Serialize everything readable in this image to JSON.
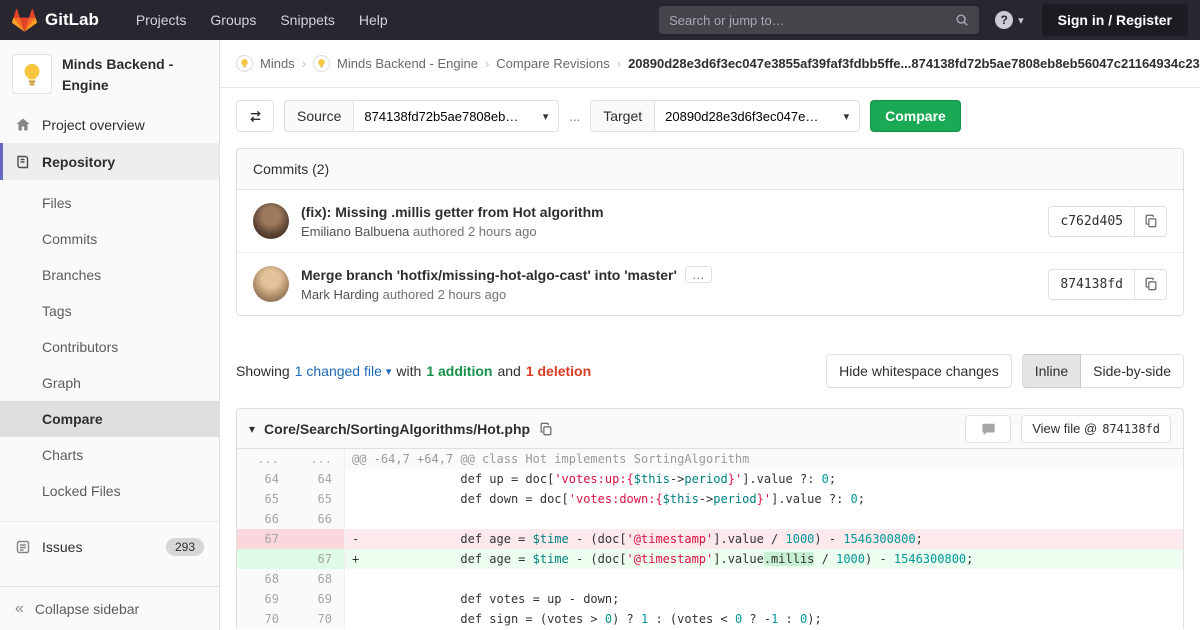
{
  "colors": {
    "navbar_bg": "#28262e",
    "brand_orange": "#e24329",
    "accent_green": "#1aaa55",
    "addition_green": "#168f48",
    "deletion_red": "#db3b21",
    "link_blue": "#1b69b6",
    "sidebar_active_accent": "#6666c4",
    "diff_deletion_bg": "#fbe9eb",
    "diff_addition_bg": "#ecfdf0",
    "diff_addition_word_bg": "#c7f0d2"
  },
  "icons": {
    "chevron_down": "▾",
    "collapse": "«",
    "breadcrumb_separator": "›",
    "ellipsis": "…",
    "question": "?"
  },
  "navbar": {
    "brand": "GitLab",
    "menu": [
      "Projects",
      "Groups",
      "Snippets",
      "Help"
    ],
    "search_placeholder": "Search or jump to…",
    "sign_in": "Sign in / Register"
  },
  "sidebar": {
    "project_title": "Minds Backend - Engine",
    "items": [
      {
        "label": "Project overview"
      },
      {
        "label": "Repository"
      },
      {
        "label": "Files"
      },
      {
        "label": "Commits"
      },
      {
        "label": "Branches"
      },
      {
        "label": "Tags"
      },
      {
        "label": "Contributors"
      },
      {
        "label": "Graph"
      },
      {
        "label": "Compare"
      },
      {
        "label": "Charts"
      },
      {
        "label": "Locked Files"
      },
      {
        "label": "Issues"
      }
    ],
    "issues_count": "293",
    "collapse_label": "Collapse sidebar"
  },
  "breadcrumb": {
    "links": [
      "Minds",
      "Minds Backend - Engine",
      "Compare Revisions"
    ],
    "current": "20890d28e3d6f3ec047e3855af39faf3fdbb5ffe...874138fd72b5ae7808eb8eb56047c21164934c23"
  },
  "compare_form": {
    "source_label": "Source",
    "source_value": "874138fd72b5ae7808eb…",
    "separator": "...",
    "target_label": "Target",
    "target_value": "20890d28e3d6f3ec047e…",
    "compare_button": "Compare"
  },
  "commits": {
    "header": "Commits (2)",
    "items": [
      {
        "title": "(fix): Missing .millis getter from Hot algorithm",
        "author": "Emiliano Balbuena",
        "meta": "authored 2 hours ago",
        "sha": "c762d405"
      },
      {
        "title": "Merge branch 'hotfix/missing-hot-algo-cast' into 'master'",
        "author": "Mark Harding",
        "meta": "authored 2 hours ago",
        "sha": "874138fd"
      }
    ]
  },
  "summary": {
    "showing": "Showing",
    "changed_file": "1 changed file",
    "with_text": "with",
    "addition": "1 addition",
    "and_text": "and",
    "deletion": "1 deletion",
    "hide_whitespace": "Hide whitespace changes",
    "inline": "Inline",
    "side_by_side": "Side-by-side"
  },
  "diff": {
    "file_path": "Core/Search/SortingAlgorithms/Hot.php",
    "view_file_label": "View file @",
    "view_file_sha": "874138fd",
    "lines": [
      {
        "type": "match",
        "old": "...",
        "new": "...",
        "prefix": "",
        "segments": [
          {
            "t": "@@ -64,7 +64,7 @@ class Hot implements SortingAlgorithm",
            "c": "m"
          }
        ]
      },
      {
        "type": "context",
        "old": "64",
        "new": "64",
        "prefix": " ",
        "segments": [
          {
            "t": "              def up = doc[",
            "c": "p"
          },
          {
            "t": "'votes:up:{",
            "c": "s"
          },
          {
            "t": "$this",
            "c": "v"
          },
          {
            "t": "->",
            "c": "p"
          },
          {
            "t": "period",
            "c": "v"
          },
          {
            "t": "}'",
            "c": "s"
          },
          {
            "t": "].value ?: ",
            "c": "p"
          },
          {
            "t": "0",
            "c": "n"
          },
          {
            "t": ";",
            "c": "p"
          }
        ]
      },
      {
        "type": "context",
        "old": "65",
        "new": "65",
        "prefix": " ",
        "segments": [
          {
            "t": "              def down = doc[",
            "c": "p"
          },
          {
            "t": "'votes:down:{",
            "c": "s"
          },
          {
            "t": "$this",
            "c": "v"
          },
          {
            "t": "->",
            "c": "p"
          },
          {
            "t": "period",
            "c": "v"
          },
          {
            "t": "}'",
            "c": "s"
          },
          {
            "t": "].value ?: ",
            "c": "p"
          },
          {
            "t": "0",
            "c": "n"
          },
          {
            "t": ";",
            "c": "p"
          }
        ]
      },
      {
        "type": "context",
        "old": "66",
        "new": "66",
        "prefix": "",
        "segments": []
      },
      {
        "type": "del",
        "old": "67",
        "new": "",
        "prefix": "-",
        "segments": [
          {
            "t": "              def age = ",
            "c": "p"
          },
          {
            "t": "$time",
            "c": "v"
          },
          {
            "t": " - (doc[",
            "c": "p"
          },
          {
            "t": "'@timestamp'",
            "c": "s"
          },
          {
            "t": "].value / ",
            "c": "p"
          },
          {
            "t": "1000",
            "c": "n"
          },
          {
            "t": ") - ",
            "c": "p"
          },
          {
            "t": "1546300800",
            "c": "n"
          },
          {
            "t": ";",
            "c": "p"
          }
        ]
      },
      {
        "type": "add",
        "old": "",
        "new": "67",
        "prefix": "+",
        "segments": [
          {
            "t": "              def age = ",
            "c": "p"
          },
          {
            "t": "$time",
            "c": "v"
          },
          {
            "t": " - (doc[",
            "c": "p"
          },
          {
            "t": "'@timestamp'",
            "c": "s"
          },
          {
            "t": "].value",
            "c": "p"
          },
          {
            "t": ".millis",
            "c": "p hl"
          },
          {
            "t": " / ",
            "c": "p"
          },
          {
            "t": "1000",
            "c": "n"
          },
          {
            "t": ") - ",
            "c": "p"
          },
          {
            "t": "1546300800",
            "c": "n"
          },
          {
            "t": ";",
            "c": "p"
          }
        ]
      },
      {
        "type": "context",
        "old": "68",
        "new": "68",
        "prefix": "",
        "segments": []
      },
      {
        "type": "context",
        "old": "69",
        "new": "69",
        "prefix": " ",
        "segments": [
          {
            "t": "              def votes = up - down;",
            "c": "p"
          }
        ]
      },
      {
        "type": "context",
        "old": "70",
        "new": "70",
        "prefix": " ",
        "segments": [
          {
            "t": "              def sign = (votes > ",
            "c": "p"
          },
          {
            "t": "0",
            "c": "n"
          },
          {
            "t": ") ? ",
            "c": "p"
          },
          {
            "t": "1",
            "c": "n"
          },
          {
            "t": " : (votes < ",
            "c": "p"
          },
          {
            "t": "0",
            "c": "n"
          },
          {
            "t": " ? -",
            "c": "p"
          },
          {
            "t": "1",
            "c": "n"
          },
          {
            "t": " : ",
            "c": "p"
          },
          {
            "t": "0",
            "c": "n"
          },
          {
            "t": ");",
            "c": "p"
          }
        ]
      }
    ]
  }
}
